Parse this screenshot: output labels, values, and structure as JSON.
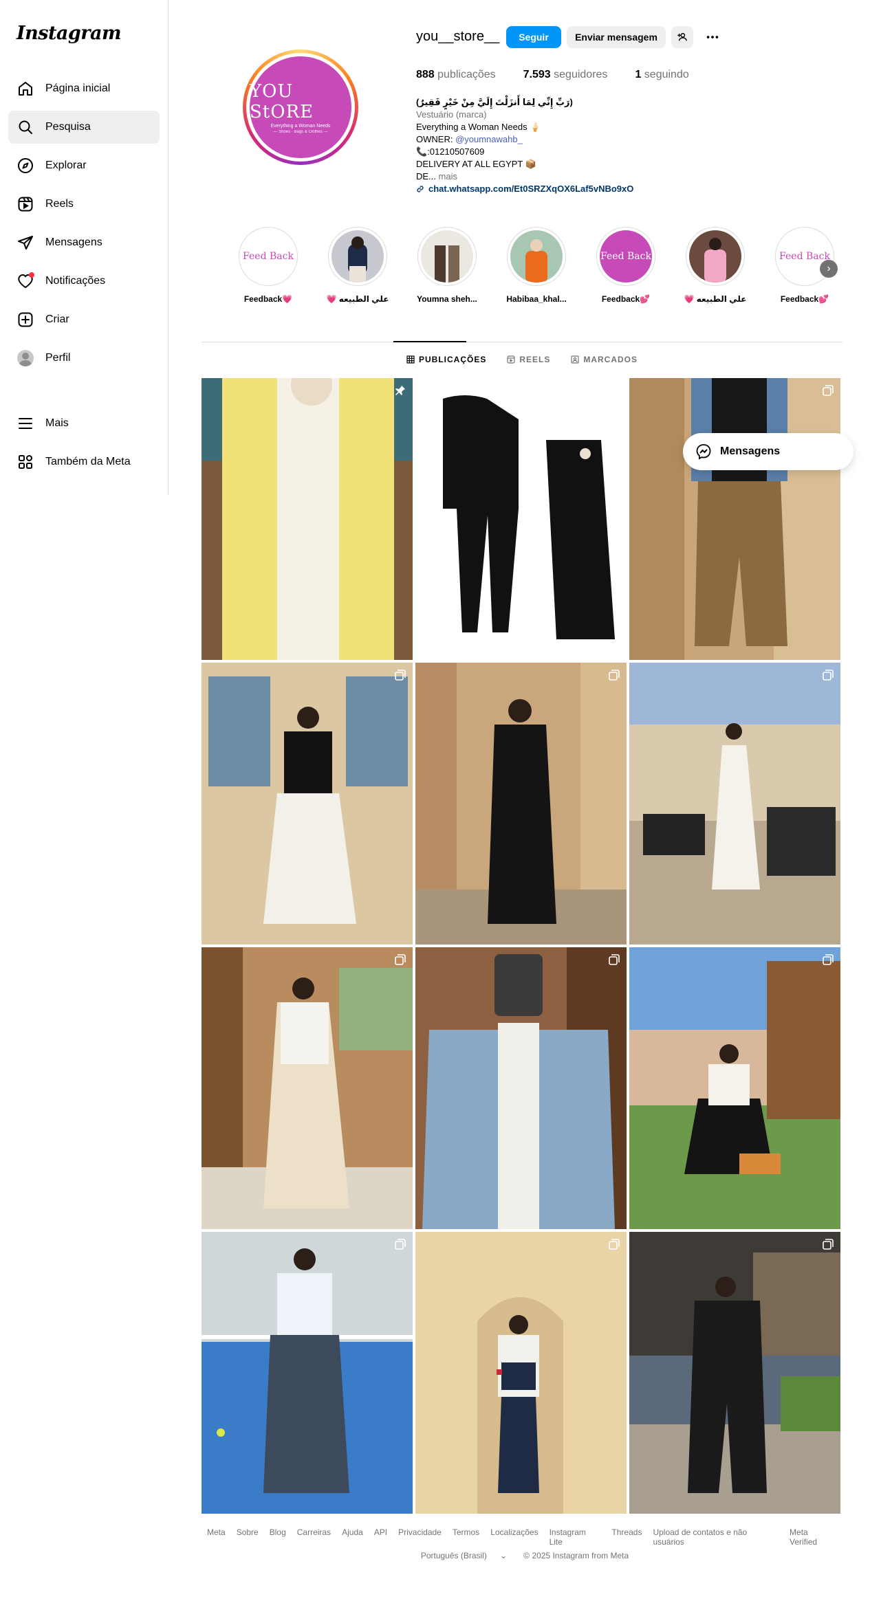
{
  "app": {
    "logo": "Instagram"
  },
  "sidebar": {
    "items": [
      {
        "label": "Página inicial",
        "icon": "home-icon"
      },
      {
        "label": "Pesquisa",
        "icon": "search-icon"
      },
      {
        "label": "Explorar",
        "icon": "compass-icon"
      },
      {
        "label": "Reels",
        "icon": "reels-icon"
      },
      {
        "label": "Mensagens",
        "icon": "send-icon"
      },
      {
        "label": "Notificações",
        "icon": "heart-icon"
      },
      {
        "label": "Criar",
        "icon": "plus-square-icon"
      },
      {
        "label": "Perfil",
        "icon": "avatar-icon"
      }
    ],
    "more": {
      "label": "Mais"
    },
    "meta": {
      "label": "Também da Meta"
    }
  },
  "profile": {
    "picture": {
      "title": "YOU StORE",
      "sub": "Everything a Woman Needs",
      "sub2": "— Shoes · Bags & Clothes —"
    },
    "username": "you__store__",
    "follow_label": "Seguir",
    "message_label": "Enviar mensagem",
    "stats": {
      "posts_count": "888",
      "posts_label": "publicações",
      "followers_count": "7.593",
      "followers_label": "seguidores",
      "following_count": "1",
      "following_label": "seguindo"
    },
    "bio": {
      "line1": "(رَبِّ إِنِّي لِمَا أَنزَلْتَ إِلَيَّ مِنْ خَيْرٍ فَقِيرٌ)",
      "category": "Vestuário (marca)",
      "line2": "Everything a Woman Needs 🍦",
      "owner_prefix": "OWNER: ",
      "owner_mention": "@youmnawahb_",
      "phone": "📞:01210507609",
      "delivery": "DELIVERY AT ALL EGYPT 📦",
      "truncated": "DE...",
      "more": " mais",
      "link_icon": "link-icon",
      "link": "chat.whatsapp.com/Et0SRZXqOX6Laf5vNBo9xO"
    }
  },
  "highlights": [
    {
      "label": "Feedback💗",
      "img_text": "Feed Back"
    },
    {
      "label": "💗 علي الطبيعه",
      "img_text": ""
    },
    {
      "label": "Youmna sheh...",
      "img_text": ""
    },
    {
      "label": "Habibaa_khal...",
      "img_text": ""
    },
    {
      "label": "Feedback💕",
      "img_text": "Feed Back"
    },
    {
      "label": "💗 علي الطبيعه",
      "img_text": ""
    },
    {
      "label": "Feedback💕",
      "img_text": "Feed Back"
    }
  ],
  "tabs": [
    {
      "label": "PUBLICAÇÕES",
      "icon": "grid-icon"
    },
    {
      "label": "REELS",
      "icon": "reels-icon"
    },
    {
      "label": "MARCADOS",
      "icon": "tagged-icon"
    }
  ],
  "posts": [
    {
      "name": "yellow-shirt-post",
      "badge": "pin-icon",
      "bg": "#e8d870"
    },
    {
      "name": "black-set-post",
      "badge": "",
      "bg": "#ffffff"
    },
    {
      "name": "denim-vest-post",
      "badge": "carousel-icon",
      "bg": "#c9a57a"
    },
    {
      "name": "white-skirt-post",
      "badge": "carousel-icon",
      "bg": "#d8c3a0"
    },
    {
      "name": "black-outfit-post",
      "badge": "carousel-icon",
      "bg": "#c9a67c"
    },
    {
      "name": "outdoor-white-dress-post",
      "badge": "carousel-icon",
      "bg": "#9fb7d6"
    },
    {
      "name": "cream-skirt-post",
      "badge": "carousel-icon",
      "bg": "#b88c5f"
    },
    {
      "name": "denim-jacket-post",
      "badge": "carousel-icon",
      "bg": "#8c6040"
    },
    {
      "name": "seated-outdoor-post",
      "badge": "carousel-icon",
      "bg": "#6fa2d8"
    },
    {
      "name": "tennis-court-post",
      "badge": "carousel-icon",
      "bg": "#3a7cc8"
    },
    {
      "name": "arch-doorway-post",
      "badge": "carousel-icon",
      "bg": "#e9d4a8"
    },
    {
      "name": "pinstripe-suit-post",
      "badge": "carousel-icon",
      "bg": "#5b6a7a"
    }
  ],
  "floating_message": {
    "label": "Mensagens"
  },
  "footer": {
    "links": [
      "Meta",
      "Sobre",
      "Blog",
      "Carreiras",
      "Ajuda",
      "API",
      "Privacidade",
      "Termos",
      "Localizações",
      "Instagram Lite",
      "Threads",
      "Upload de contatos e não usuários",
      "Meta Verified"
    ],
    "language": "Português (Brasil)",
    "copyright": "© 2025 Instagram from Meta"
  }
}
